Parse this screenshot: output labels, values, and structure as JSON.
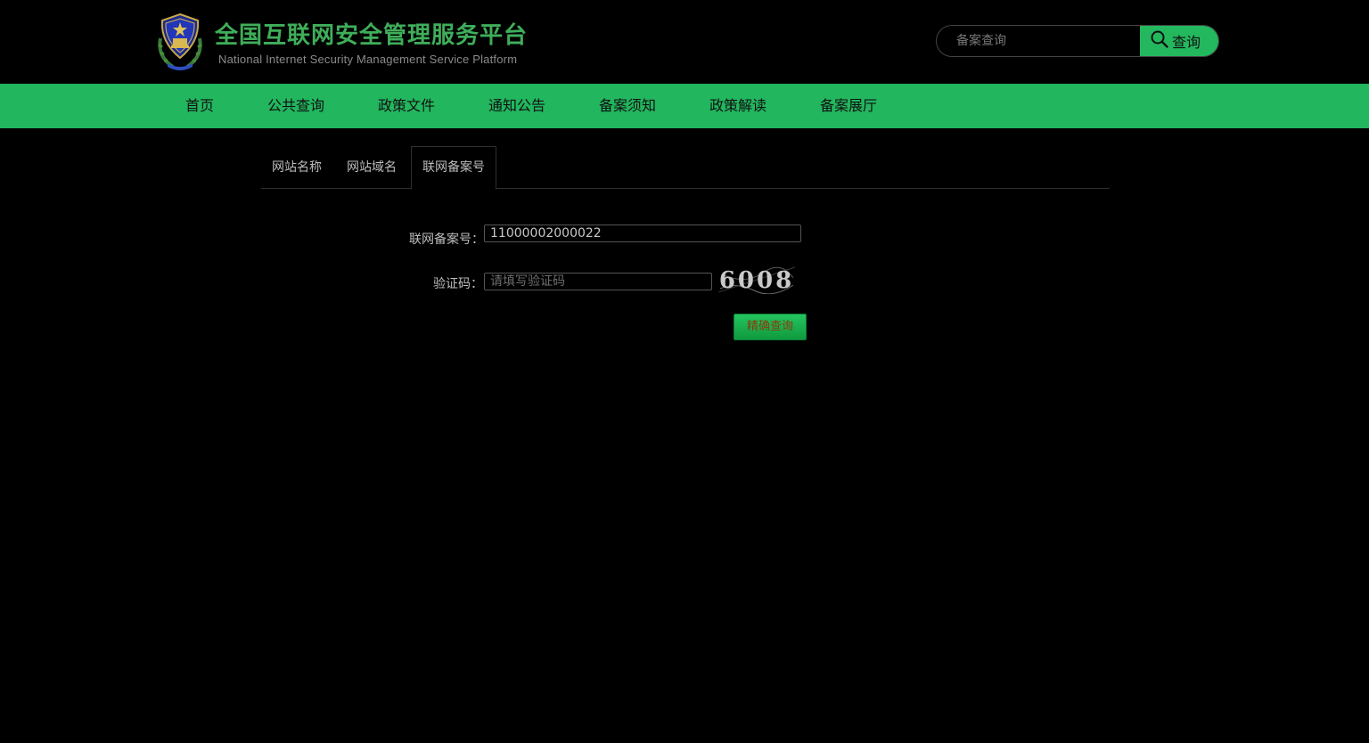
{
  "header": {
    "logo_icon": "police-emblem-icon",
    "title": "全国互联网安全管理服务平台",
    "subtitle": "National Internet Security Management Service Platform",
    "search": {
      "placeholder": "备案查询",
      "button_label": "查询",
      "button_icon": "search-icon"
    }
  },
  "nav": {
    "items": [
      {
        "label": "首页"
      },
      {
        "label": "公共查询"
      },
      {
        "label": "政策文件"
      },
      {
        "label": "通知公告"
      },
      {
        "label": "备案须知"
      },
      {
        "label": "政策解读"
      },
      {
        "label": "备案展厅"
      }
    ]
  },
  "tabs": [
    {
      "label": "网站名称",
      "active": false
    },
    {
      "label": "网站域名",
      "active": false
    },
    {
      "label": "联网备案号",
      "active": true
    }
  ],
  "form": {
    "record_label": "联网备案号：",
    "record_value": "11000002000022",
    "captcha_label": "验证码：",
    "captcha_placeholder": "请填写验证码",
    "captcha_text": "6008",
    "submit_label": "精确查询"
  },
  "colors": {
    "brand_green": "#22b65e",
    "title_green": "#3fae5a",
    "background": "#000000"
  }
}
